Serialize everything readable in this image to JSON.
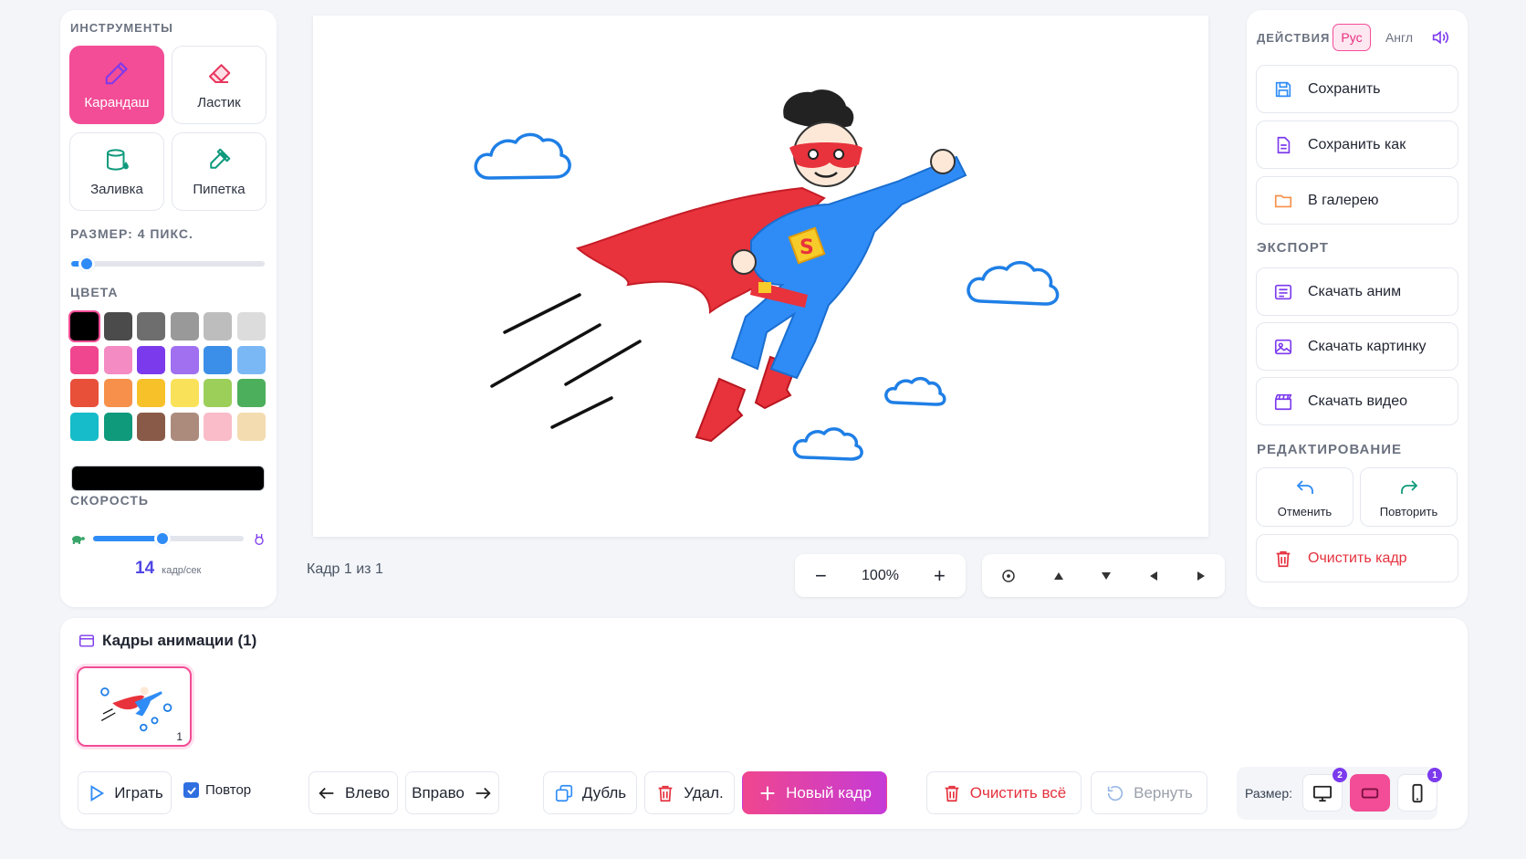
{
  "tools": {
    "title": "ИНСТРУМЕНТЫ",
    "pencil": "Карандаш",
    "eraser": "Ластик",
    "fill": "Заливка",
    "eyedropper": "Пипетка",
    "active": "pencil"
  },
  "size": {
    "label": "РАЗМЕР: 4 ПИКС.",
    "value": 4,
    "min": 1,
    "max": 50
  },
  "colors": {
    "title": "ЦВЕТА",
    "swatches": [
      "#000000",
      "#4b4b4b",
      "#6e6e6e",
      "#999999",
      "#bdbdbd",
      "#dcdcdc",
      "#f0468f",
      "#f58bc3",
      "#7c3aed",
      "#a070f0",
      "#3b8fe8",
      "#7ab8f5",
      "#e8503a",
      "#f6904a",
      "#f7c12a",
      "#f9e25a",
      "#9ccf5a",
      "#4caf5c",
      "#16bcc9",
      "#0f9a7c",
      "#8a5a48",
      "#ad8b7c",
      "#f9bcc8",
      "#f3dcb0"
    ],
    "selected": "#000000",
    "current": "#000000"
  },
  "speed": {
    "title": "СКОРОСТЬ",
    "value": "14",
    "unit": "кадр/сек",
    "fraction": 0.46
  },
  "actions": {
    "title": "ДЕЙСТВИЯ",
    "lang_ru": "Рус",
    "lang_en": "Англ",
    "save": "Сохранить",
    "save_as": "Сохранить как",
    "to_gallery": "В галерею"
  },
  "export": {
    "title": "ЭКСПОРТ",
    "download_anim": "Скачать аним",
    "download_image": "Скачать картинку",
    "download_video": "Скачать видео"
  },
  "editing": {
    "title": "РЕДАКТИРОВАНИЕ",
    "undo": "Отменить",
    "redo": "Повторить",
    "clear_frame": "Очистить кадр"
  },
  "canvas": {
    "frame_info": "Кадр 1 из 1"
  },
  "zoom": {
    "minus": "−",
    "value": "100%",
    "plus": "+"
  },
  "frames": {
    "title": "Кадры анимации (1)",
    "items": [
      {
        "number": "1"
      }
    ]
  },
  "controls": {
    "play": "Играть",
    "loop": "Повтор",
    "loop_checked": true,
    "left": "Влево",
    "right": "Вправо",
    "duplicate": "Дубль",
    "delete": "Удал.",
    "new_frame": "Новый кадр",
    "clear_all": "Очистить всё",
    "restore": "Вернуть",
    "size_label": "Размер:",
    "desktop_badge": "2",
    "mobile_badge": "1"
  }
}
